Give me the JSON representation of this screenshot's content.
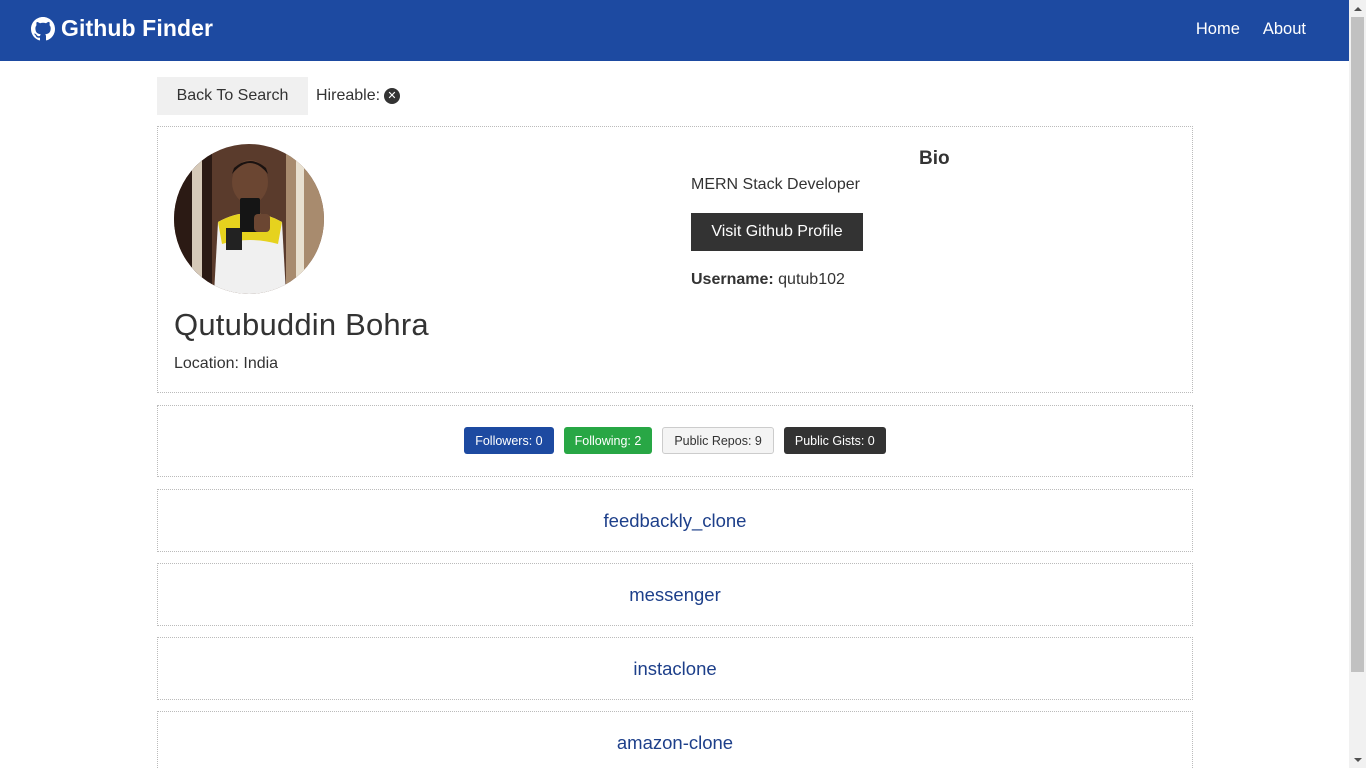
{
  "navbar": {
    "brand": "Github Finder",
    "links": [
      "Home",
      "About"
    ]
  },
  "actions": {
    "back_label": "Back To Search",
    "hireable_label": "Hireable:",
    "hireable_icon": "x-circle-icon"
  },
  "profile": {
    "name": "Qutubuddin Bohra",
    "location": "Location: India",
    "bio_title": "Bio",
    "bio": "MERN Stack Developer",
    "visit_label": "Visit Github Profile",
    "username_label": "Username:",
    "username": "qutub102"
  },
  "stats": {
    "followers": "Followers: 0",
    "following": "Following: 2",
    "repos": "Public Repos: 9",
    "gists": "Public Gists: 0"
  },
  "repos": [
    "feedbackly_clone",
    "messenger",
    "instaclone",
    "amazon-clone"
  ],
  "colors": {
    "primary": "#1d4aa1",
    "success": "#28a745",
    "dark": "#333333",
    "light": "#f4f4f4"
  }
}
